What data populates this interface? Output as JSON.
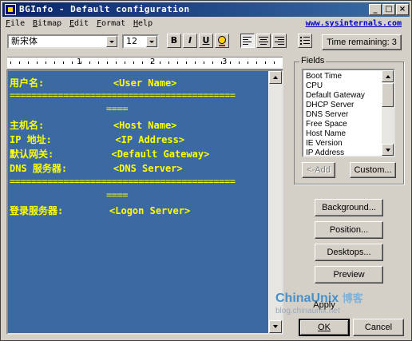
{
  "window": {
    "title": "BGInfo - Default configuration"
  },
  "titlebar": {
    "min": "_",
    "max": "□",
    "close": "×"
  },
  "menu": {
    "items": [
      {
        "first": "F",
        "rest": "ile"
      },
      {
        "first": "B",
        "rest": "itmap"
      },
      {
        "first": "E",
        "rest": "dit"
      },
      {
        "first": "F",
        "rest": "ormat"
      },
      {
        "first": "H",
        "rest": "elp"
      }
    ],
    "link": "www.sysinternals.com"
  },
  "toolbar": {
    "font": "新宋体",
    "size": "12",
    "bold": "B",
    "italic": "I",
    "underline": "U",
    "time_remaining": "Time remaining: 3"
  },
  "ruler": {
    "nums": [
      "1",
      "2",
      "3"
    ]
  },
  "editor": {
    "lines": [
      "用户名:            <User Name>",
      "==========================================",
      "                  ====",
      "主机名:            <Host Name>",
      "IP 地址:           <IP Address>",
      "默认网关:          <Default Gateway>",
      "DNS 服务器:        <DNS Server>",
      "==========================================",
      "                  ====",
      "登录服务器:        <Logon Server>"
    ]
  },
  "fields": {
    "label": "Fields",
    "items": [
      "Boot Time",
      "CPU",
      "Default Gateway",
      "DHCP Server",
      "DNS Server",
      "Free Space",
      "Host Name",
      "IE Version",
      "IP Address"
    ],
    "add": "<-Add",
    "custom": "Custom..."
  },
  "buttons": {
    "background": "Background...",
    "position": "Position...",
    "desktops": "Desktops...",
    "preview": "Preview",
    "apply": "Apply",
    "ok": "OK",
    "cancel": "Cancel"
  },
  "watermark": {
    "brand": "ChinaUnix",
    "brand_cn": "博客",
    "url": "blog.chinaunix.net"
  },
  "colors": {
    "editor_bg": "#3b6aa3",
    "editor_text": "#ffff00",
    "titlebar": "#0a246a"
  }
}
